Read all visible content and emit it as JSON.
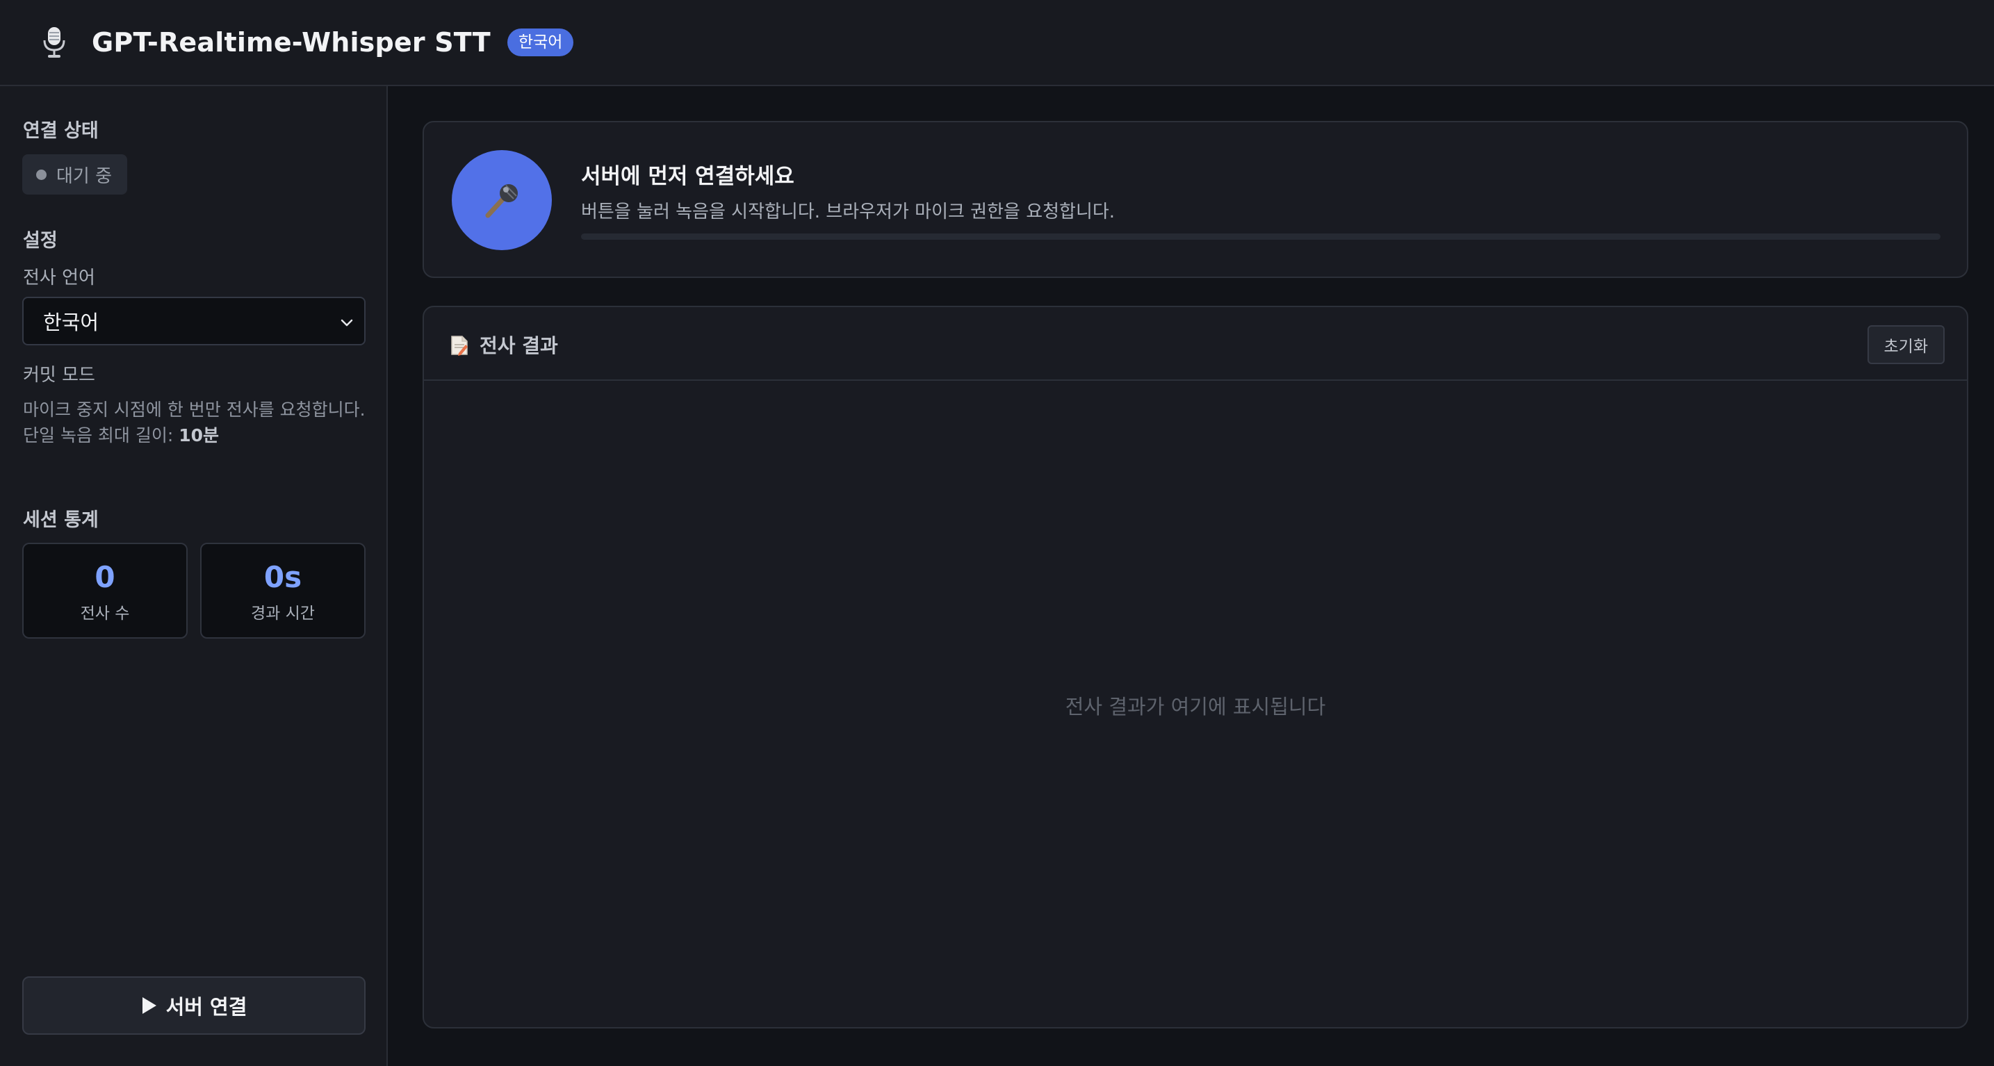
{
  "header": {
    "logo_icon": "microphone-icon",
    "title": "GPT-Realtime-Whisper STT",
    "language_badge": "한국어"
  },
  "sidebar": {
    "connection_title": "연결 상태",
    "status": {
      "text": "대기 중",
      "dot_color": "#8b909a"
    },
    "settings_title": "설정",
    "language_label": "전사 언어",
    "language_value": "한국어",
    "commit_mode_label": "커밋 모드",
    "commit_mode_desc": "마이크 중지 시점에 한 번만 전사를 요청합니다.",
    "max_length_prefix": "단일 녹음 최대 길이: ",
    "max_length_value": "10분",
    "stats_title": "세션 통계",
    "stats": [
      {
        "value": "0",
        "label": "전사 수"
      },
      {
        "value": "0s",
        "label": "경과 시간"
      }
    ],
    "connect_button": "서버 연결"
  },
  "recorder": {
    "icon": "microphone-icon",
    "title": "서버에 먼저 연결하세요",
    "subtitle": "버튼을 눌러 녹음을 시작합니다. 브라우저가 마이크 권한을 요청합니다.",
    "progress": 0
  },
  "results": {
    "icon": "document-icon",
    "title": "전사 결과",
    "reset_button": "초기화",
    "empty_text": "전사 결과가 여기에 표시됩니다"
  },
  "colors": {
    "accent": "#5271e8",
    "stat_value": "#7ea2ff",
    "background": "#111318",
    "panel": "#181a20"
  }
}
